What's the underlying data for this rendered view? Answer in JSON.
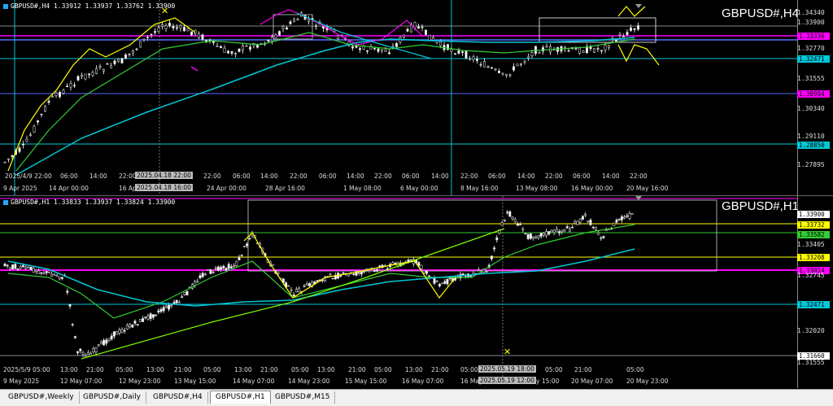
{
  "h4": {
    "header": "GBPUSD#,H4  1.33912 1.33937 1.33762 1.33900",
    "title": "GBPUSD#,H4",
    "price_labels": [
      "1.34340",
      "1.33900",
      "1.33336",
      "1.32770",
      "1.32471",
      "1.31555",
      "1.30984",
      "1.30340",
      "1.29110",
      "1.28850",
      "1.27895"
    ],
    "time_labels": [
      "2025/4/9 22:00",
      "06:00",
      "14:00",
      "22:00",
      "22:00",
      "06:00",
      "14:00",
      "22:00",
      "06:00",
      "14:00",
      "22:00",
      "06:00",
      "14:00",
      "22:00",
      "06:00",
      "14:00",
      "22:00",
      "06:00",
      "14:00",
      "22:00"
    ],
    "date_labels": [
      "9 Apr 2025",
      "14 Apr 00:00",
      "16 Apr 08:00",
      "24 Apr 00:00",
      "28 Apr 16:00",
      "1 May 08:00",
      "6 May 00:00",
      "8 May 16:00",
      "13 May 08:00",
      "16 May 00:00",
      "20 May 16:00"
    ],
    "cursor_time_top": "2025.04.18 22:00",
    "cursor_time_bottom": "2025.04.18 16:00"
  },
  "h1": {
    "header": "GBPUSD#,H1  1.33833 1.33937 1.33824 1.33900",
    "title": "GBPUSD#,H1",
    "price_labels": [
      "1.33900",
      "1.33732",
      "1.33582",
      "1.33405",
      "1.33208",
      "1.33014",
      "1.32745",
      "1.32471",
      "1.32020",
      "1.31660",
      "1.31555"
    ],
    "date_labels": [
      "9 May 2025",
      "12 May 07:00",
      "12 May 23:00",
      "13 May 15:00",
      "14 May 07:00",
      "14 May 23:00",
      "15 May 15:00",
      "16 May 07:00",
      "16 May 23:00",
      "19 May 15:00",
      "20 May 07:00",
      "20 May 23:00"
    ],
    "time_labels": [
      "2025/5/9 05:00",
      "13:00",
      "21:00",
      "05:00",
      "13:00",
      "21:00",
      "05:00",
      "13:00",
      "21:00",
      "05:00",
      "13:00",
      "21:00",
      "05:00",
      "13:00",
      "21:00",
      "05:00",
      "13:00",
      "21:00",
      "05:00",
      "21:00",
      "05:00"
    ],
    "cursor_time_top": "2025.05.19 18:00",
    "cursor_time_bottom": "2025.05.19 12:00"
  },
  "tabs": [
    "GBPUSD#,Weekly",
    "GBPUSD#,Daily",
    "GBPUSD#,H4",
    "GBPUSD#,H1",
    "GBPUSD#,M15"
  ],
  "active_tab": "GBPUSD#,H1",
  "colors": {
    "magenta": "#ff00ff",
    "cyan": "#00c8d8",
    "yellow": "#ffff00",
    "green": "#32cd32",
    "lightgreen": "#7CFC00",
    "blue": "#5a6cff",
    "white": "#ffffff"
  }
}
